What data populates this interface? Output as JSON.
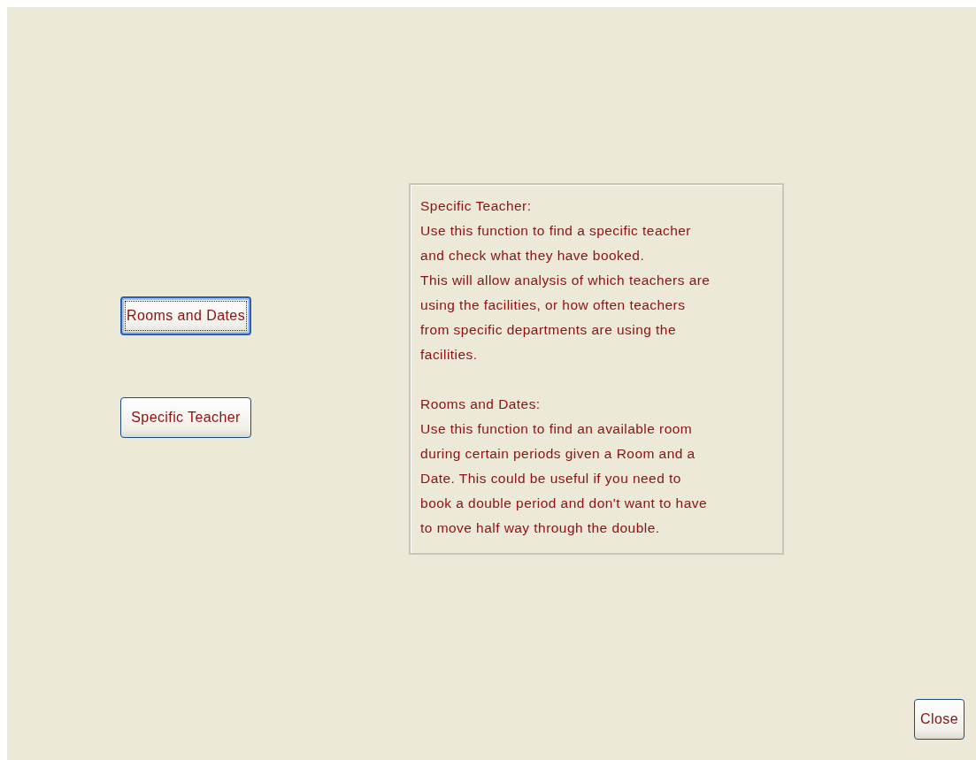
{
  "buttons": [
    {
      "label": "Rooms and Dates",
      "focused": true
    },
    {
      "label": "Specific Teacher",
      "focused": false
    }
  ],
  "help": [
    {
      "heading": "Specific Teacher:",
      "lines": [
        "Use this function to find a specific teacher",
        "and check what they have booked.",
        "This will allow analysis of which teachers are",
        "using the facilities, or how often teachers",
        "from specific departments are using the",
        "facilities."
      ]
    },
    {
      "heading": "Rooms and Dates:",
      "lines": [
        "Use this function to find an available room",
        "during certain periods given a Room and a",
        "Date. This could be useful if you need to",
        "book a double period and don't want to have",
        "to move half way through the double."
      ]
    }
  ],
  "close_button": "Close"
}
